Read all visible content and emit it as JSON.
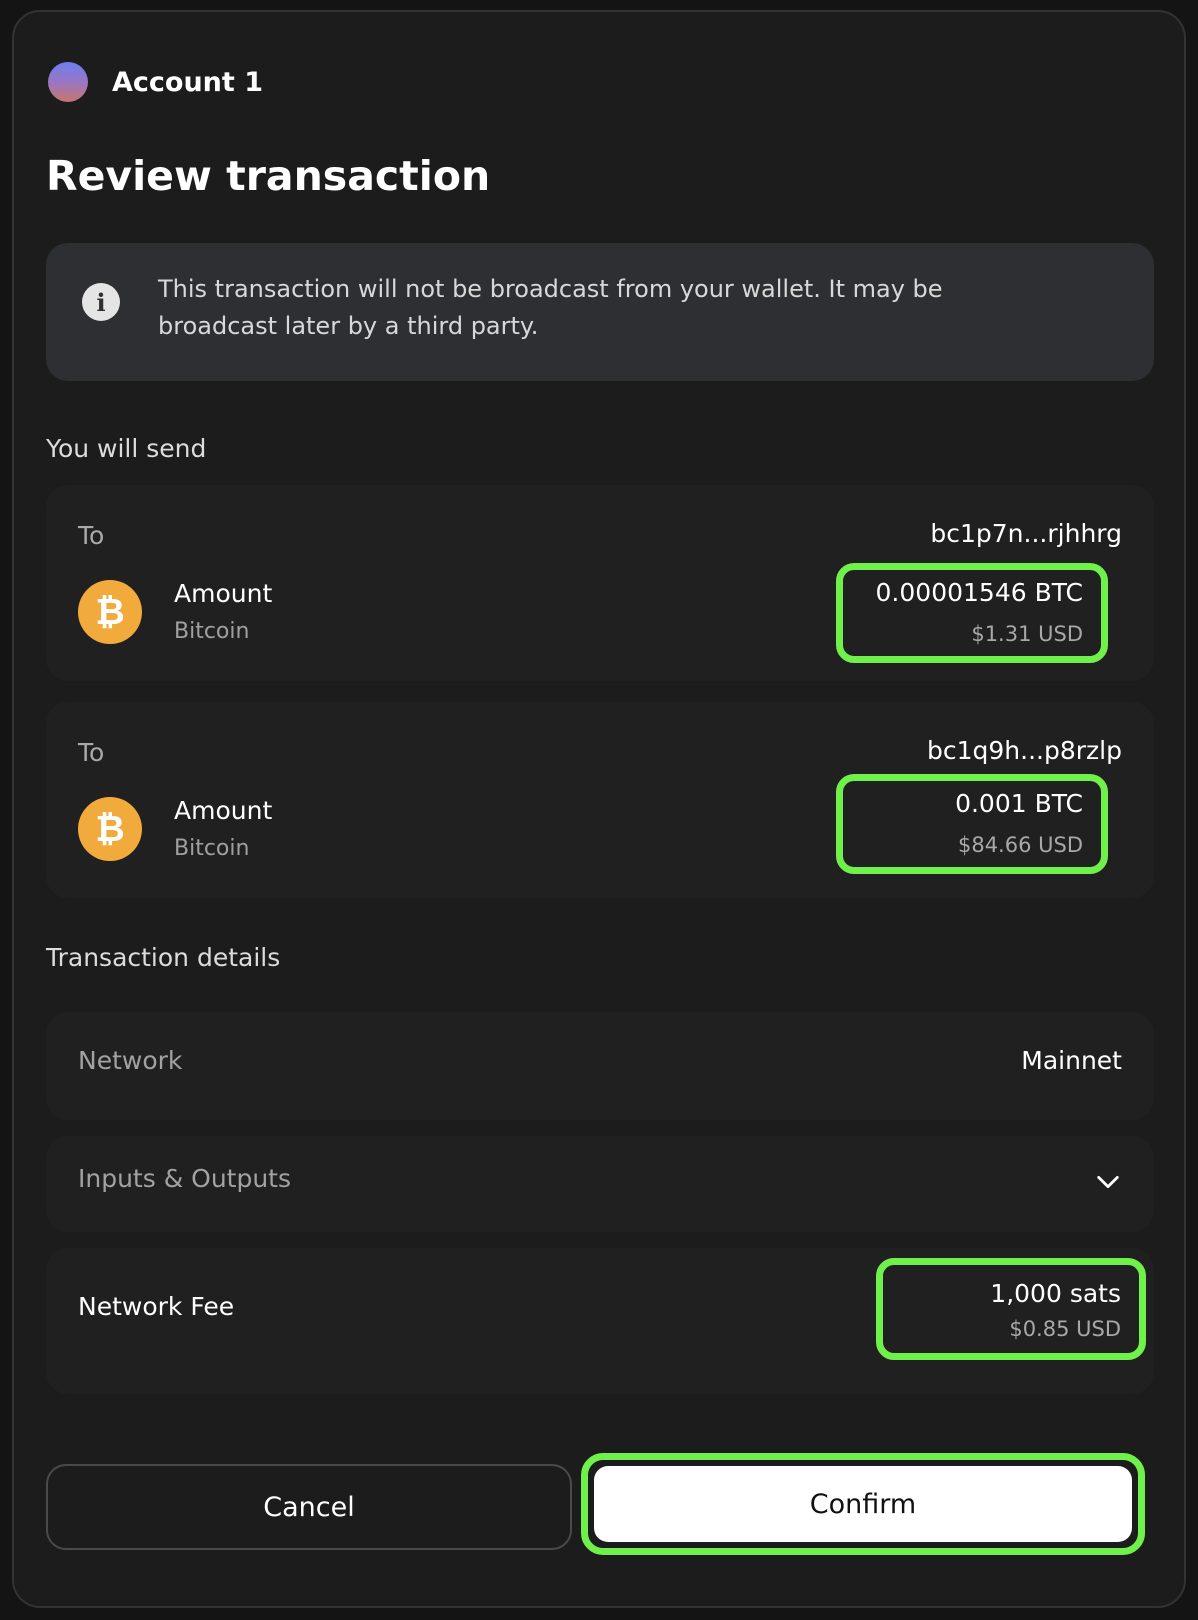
{
  "account": {
    "name": "Account 1"
  },
  "title": "Review transaction",
  "notice": {
    "icon": "info-icon",
    "text": "This transaction will not be broadcast from your wallet. It may be broadcast later by a third party."
  },
  "send_section": {
    "label": "You will send",
    "outputs": [
      {
        "to_label": "To",
        "address": "bc1p7n...rjhhrg",
        "amount_label": "Amount",
        "asset": "Bitcoin",
        "asset_icon": "bitcoin-icon",
        "amount": "0.00001546 BTC",
        "usd": "$1.31 USD"
      },
      {
        "to_label": "To",
        "address": "bc1q9h...p8rzlp",
        "amount_label": "Amount",
        "asset": "Bitcoin",
        "asset_icon": "bitcoin-icon",
        "amount": "0.001 BTC",
        "usd": "$84.66 USD"
      }
    ]
  },
  "details_section": {
    "label": "Transaction details",
    "network_label": "Network",
    "network_value": "Mainnet",
    "inputs_outputs_label": "Inputs & Outputs",
    "fee_label": "Network Fee",
    "fee_value": "1,000 sats",
    "fee_usd": "$0.85 USD"
  },
  "actions": {
    "cancel_label": "Cancel",
    "confirm_label": "Confirm"
  },
  "colors": {
    "background": "#1c1c1c",
    "card": "#202020",
    "highlight": "#6ff04a",
    "bitcoin": "#f0ab3c"
  }
}
